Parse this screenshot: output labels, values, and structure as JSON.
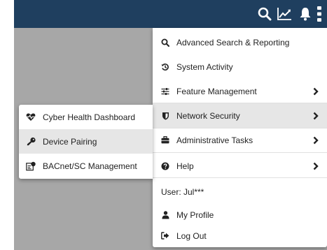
{
  "colors": {
    "topbar": "#1f3f5f",
    "backdrop": "#a7a7a7",
    "menu_bg": "#ffffff",
    "active_item_bg": "#e6e6e6",
    "text": "#222222"
  },
  "topbar": {
    "icons": [
      "search-icon",
      "trend-chart-icon",
      "bell-icon",
      "vertical-ellipsis-icon"
    ]
  },
  "menu": {
    "items": [
      {
        "label": "Advanced Search & Reporting",
        "icon": "search-icon"
      },
      {
        "label": "System Activity",
        "icon": "history-icon"
      },
      {
        "label": "Feature Management",
        "icon": "sliders-icon",
        "has_submenu": true
      },
      {
        "label": "Network Security",
        "icon": "shield-icon",
        "has_submenu": true,
        "active": true
      },
      {
        "label": "Administrative Tasks",
        "icon": "briefcase-icon",
        "has_submenu": true
      },
      {
        "label": "Help",
        "icon": "question-circle-icon",
        "has_submenu": true
      }
    ],
    "user_label": "User: Jul***",
    "profile_items": [
      {
        "label": "My Profile",
        "icon": "user-icon"
      },
      {
        "label": "Log Out",
        "icon": "sign-out-icon"
      }
    ]
  },
  "submenu": {
    "parent": "Network Security",
    "items": [
      {
        "label": "Cyber Health Dashboard",
        "icon": "heartbeat-icon"
      },
      {
        "label": "Device Pairing",
        "icon": "key-icon",
        "active": true
      },
      {
        "label": "BACnet/SC Management",
        "icon": "certificate-icon"
      }
    ]
  }
}
